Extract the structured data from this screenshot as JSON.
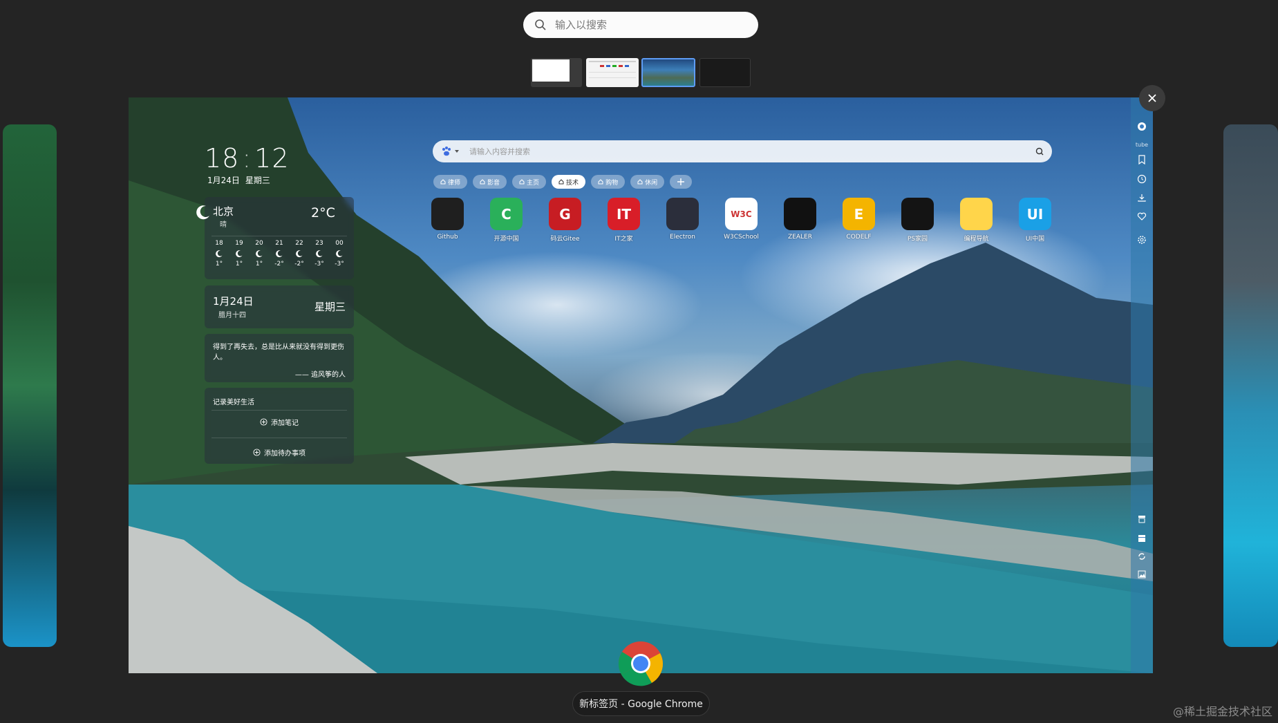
{
  "overview": {
    "search_placeholder": "输入以搜索",
    "window_title": "新标签页 - Google Chrome"
  },
  "newtab": {
    "clock": {
      "hour": "18",
      "minute": "12",
      "date": "1月24日",
      "weekday": "星期三"
    },
    "weather": {
      "city": "北京",
      "condition": "晴",
      "temp": "2°C",
      "hours": [
        {
          "h": "18",
          "t": "1°"
        },
        {
          "h": "19",
          "t": "1°"
        },
        {
          "h": "20",
          "t": "1°"
        },
        {
          "h": "21",
          "t": "-2°"
        },
        {
          "h": "22",
          "t": "-2°"
        },
        {
          "h": "23",
          "t": "-3°"
        },
        {
          "h": "00",
          "t": "-3°"
        }
      ]
    },
    "calendar": {
      "date": "1月24日",
      "lunar": "腊月十四",
      "weekday": "星期三"
    },
    "quote": {
      "text": "得到了再失去，总是比从来就没有得到更伤人。",
      "author": "—— 追风筝的人"
    },
    "note": {
      "title": "记录美好生活",
      "add_note": "添加笔记",
      "add_todo": "添加待办事项"
    },
    "search": {
      "placeholder": "请输入内容并搜索"
    },
    "tags": [
      {
        "label": "律师",
        "active": false
      },
      {
        "label": "影音",
        "active": false
      },
      {
        "label": "主页",
        "active": false
      },
      {
        "label": "技术",
        "active": true
      },
      {
        "label": "购物",
        "active": false
      },
      {
        "label": "休闲",
        "active": false
      }
    ],
    "apps": [
      {
        "label": "Github",
        "color": "#1f1f1f",
        "glyph": ""
      },
      {
        "label": "开源中国",
        "color": "#2ab05a",
        "glyph": "C"
      },
      {
        "label": "码云Gitee",
        "color": "#c71d23",
        "glyph": "G"
      },
      {
        "label": "IT之家",
        "color": "#d81e28",
        "glyph": "IT"
      },
      {
        "label": "Electron",
        "color": "#2b2e3b",
        "glyph": ""
      },
      {
        "label": "W3CSchool",
        "color": "#ffffff",
        "glyph": "W3C"
      },
      {
        "label": "ZEALER",
        "color": "#111111",
        "glyph": ""
      },
      {
        "label": "CODELF",
        "color": "#f4b400",
        "glyph": "E"
      },
      {
        "label": "PS家园",
        "color": "#141414",
        "glyph": ""
      },
      {
        "label": "编程导航",
        "color": "#ffd54a",
        "glyph": ""
      },
      {
        "label": "UI中国",
        "color": "#1aa0e6",
        "glyph": "UI"
      }
    ],
    "rail_label": "tube"
  },
  "watermark": "@稀土掘金技术社区"
}
